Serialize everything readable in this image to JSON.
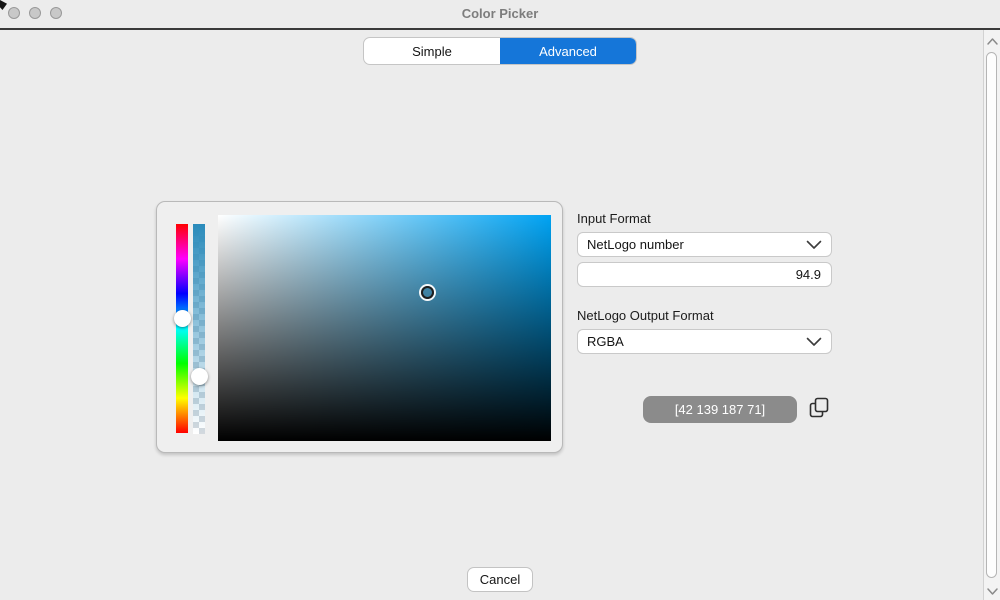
{
  "window": {
    "title": "Color Picker"
  },
  "titlebar": {
    "buttons": [
      {
        "name": "close",
        "icon": "close-circle-icon"
      },
      {
        "name": "minimize",
        "icon": "minimize-circle-icon"
      },
      {
        "name": "zoom",
        "icon": "zoom-circle-icon"
      }
    ]
  },
  "tabs": {
    "items": [
      {
        "label": "Simple",
        "active": false
      },
      {
        "label": "Advanced",
        "active": true
      }
    ]
  },
  "input_format": {
    "label": "Input Format",
    "dropdown_value": "NetLogo number",
    "number_value": "94.9"
  },
  "output_format": {
    "label": "NetLogo Output Format",
    "dropdown_value": "RGBA"
  },
  "output": {
    "value": "[42 139 187 71]"
  },
  "actions": {
    "cancel_label": "Cancel"
  },
  "icons": {
    "dropdown": "chevron-down-icon",
    "copy": "copy-icon",
    "scrollbar_up": "chevron-up-icon",
    "scrollbar_down": "chevron-down-icon"
  },
  "colors": {
    "accent": "#1576d9",
    "selected_rgb": "42,139,187",
    "gradient_hue_top": "#00a3f3",
    "output_pill": "#8b8b8b"
  }
}
